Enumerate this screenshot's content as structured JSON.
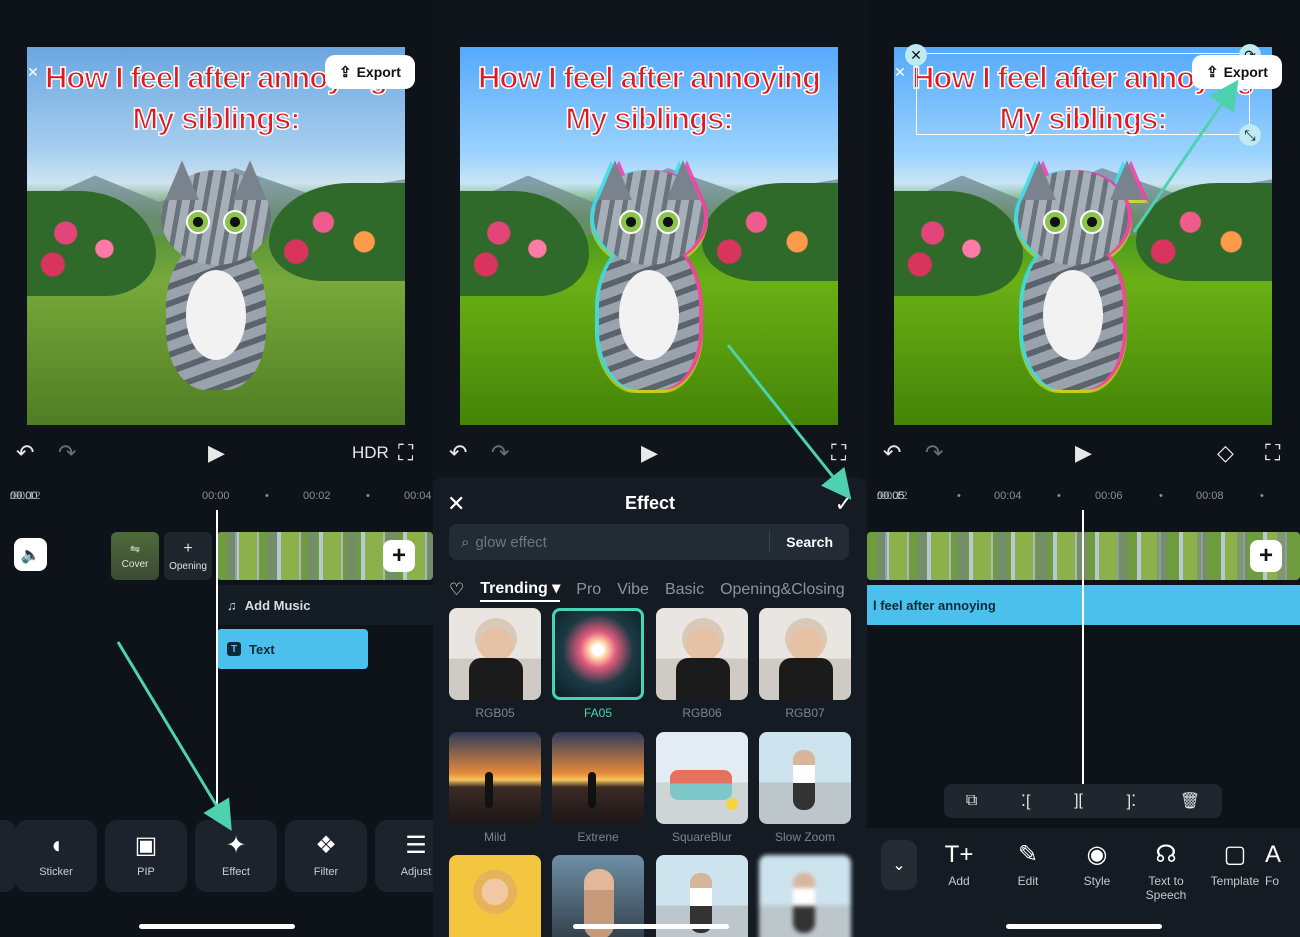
{
  "caption": {
    "line1": "How I feel after annoying",
    "line2": "My siblings:"
  },
  "export_label": "Export",
  "panel1": {
    "time_current": "00:00",
    "time_total": "/00:12",
    "ruler": [
      "00:00",
      "00:02",
      "00:04"
    ],
    "cover_label": "Cover",
    "opening_label": "Opening",
    "add_music_label": "Add Music",
    "text_label": "Text",
    "tools": [
      {
        "label": "Sticker",
        "icon": "sticker-icon"
      },
      {
        "label": "PIP",
        "icon": "pip-icon"
      },
      {
        "label": "Effect",
        "icon": "effect-icon"
      },
      {
        "label": "Filter",
        "icon": "filter-icon"
      },
      {
        "label": "Adjust",
        "icon": "adjust-icon"
      }
    ]
  },
  "effect_sheet": {
    "title": "Effect",
    "search_value": "",
    "search_placeholder": "glow effect",
    "search_button": "Search",
    "tabs": [
      "Trending",
      "Pro",
      "Vibe",
      "Basic",
      "Opening&Closing"
    ],
    "active_tab": "Trending",
    "effects": [
      {
        "name": "RGB05",
        "thumb": "th-girl",
        "selected": false
      },
      {
        "name": "FA05",
        "thumb": "th-fa",
        "selected": true
      },
      {
        "name": "RGB06",
        "thumb": "th-girl",
        "selected": false
      },
      {
        "name": "RGB07",
        "thumb": "th-girl",
        "selected": false
      },
      {
        "name": "Mild",
        "thumb": "th-sunset",
        "selected": false
      },
      {
        "name": "Extrene",
        "thumb": "th-sunset",
        "selected": false
      },
      {
        "name": "SquareBlur",
        "thumb": "th-van",
        "selected": false
      },
      {
        "name": "Slow Zoom",
        "thumb": "th-skate",
        "selected": false
      },
      {
        "name": "",
        "thumb": "th-yellow",
        "selected": false
      },
      {
        "name": "",
        "thumb": "th-woman",
        "selected": false
      },
      {
        "name": "",
        "thumb": "th-skate",
        "selected": false
      },
      {
        "name": "",
        "thumb": "th-skate",
        "selected": false
      }
    ]
  },
  "panel3": {
    "time_current": "00:05",
    "time_total": "/00:12",
    "ruler": [
      "00:04",
      "00:06",
      "00:08"
    ],
    "text_track_label": "l feel after annoying",
    "tools": [
      {
        "label": "Add",
        "icon": "add-text-icon"
      },
      {
        "label": "Edit",
        "icon": "edit-icon"
      },
      {
        "label": "Style",
        "icon": "style-icon"
      },
      {
        "label": "Text to Speech",
        "icon": "text-to-speech-icon"
      },
      {
        "label": "Template",
        "icon": "template-icon"
      },
      {
        "label": "Fo",
        "icon": "font-icon"
      }
    ]
  },
  "colors": {
    "accent": "#47d4b6",
    "text_track": "#4cc0ec",
    "caption": "#e0191f"
  }
}
